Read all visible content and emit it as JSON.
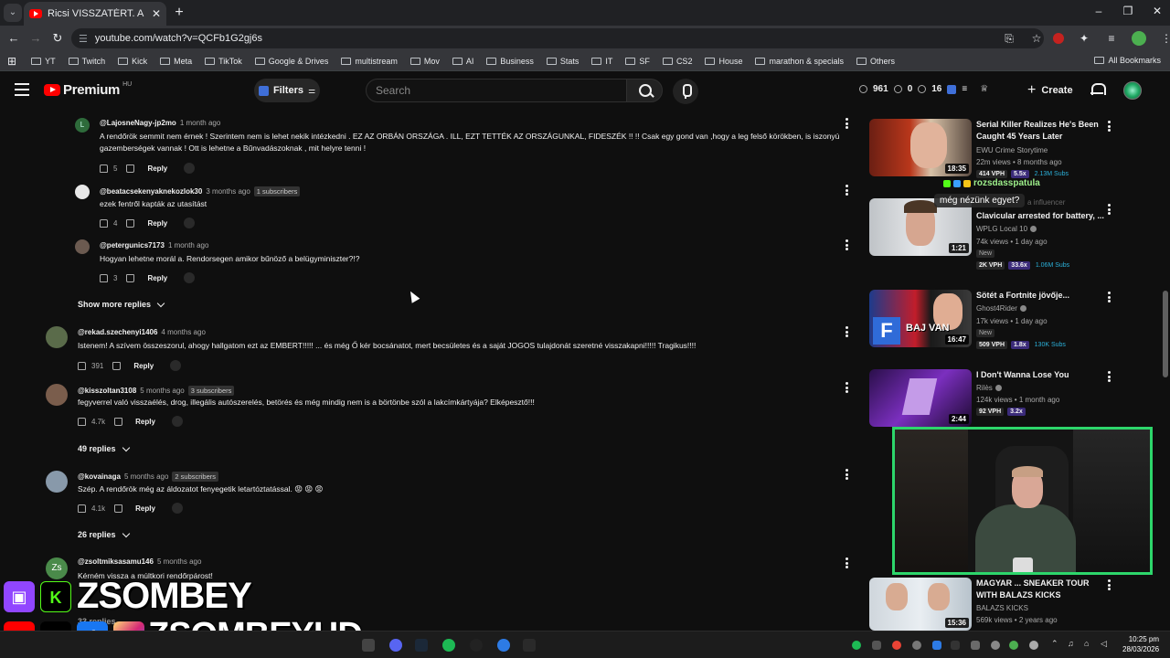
{
  "browser": {
    "tab_title": "Ricsi VISSZATÉRT.  A rendőrség",
    "url": "youtube.com/watch?v=QCFb1G2gj6s",
    "bookmarks": [
      "YT",
      "Twitch",
      "Kick",
      "Meta",
      "TikTok",
      "Google & Drives",
      "multistream",
      "Mov",
      "AI",
      "Business",
      "Stats",
      "IT",
      "SF",
      "CS2",
      "House",
      "marathon & specials",
      "Others"
    ],
    "all_bookmarks": "All Bookmarks"
  },
  "header": {
    "logo": "Premium",
    "country": "HU",
    "filters_label": "Filters",
    "search_placeholder": "Search",
    "stat1": "961",
    "stat2": "0",
    "stat3": "16",
    "create_label": "Create"
  },
  "comments": [
    {
      "handle": "@LajosneNagy-jp2mo",
      "time": "1 month ago",
      "subs": "",
      "text": "A rendőrök semmit nem érnek ! Szerintem nem is lehet nekik intézkedni . EZ AZ ORBÁN ORSZÁGA . ILL, EZT TETTÉK AZ ORSZÁGUNKAL, FIDESZÉK !! !! Csak egy gond van ,hogy a leg felső  körökben, is iszonyú gazemberségek vannak ! Ott is lehetne a Bűnvadászoknak , mit helyre tenni !",
      "likes": "5",
      "reply": "Reply",
      "avatar_letter": "L"
    },
    {
      "handle": "@beatacsekenyaknekozlok30",
      "time": "3 months ago",
      "subs": "1 subscribers",
      "text": "ezek fentről kapták az utasítást",
      "likes": "4",
      "reply": "Reply",
      "avatar_letter": ""
    },
    {
      "handle": "@petergunics7173",
      "time": "1 month ago",
      "subs": "",
      "text": "Hogyan lehetne morál a. Rendorsegen amikor bűnöző a belügyminiszter?!?",
      "likes": "3",
      "reply": "Reply",
      "avatar_letter": ""
    },
    {
      "handle": "@rekad.szechenyi1406",
      "time": "4 months ago",
      "subs": "",
      "text": "Istenem! A szívem összeszorul, ahogy hallgatom ezt az EMBERT!!!!! ... és még Ő kér bocsánatot, mert becsületes és a saját JOGOS tulajdonát szeretné visszakapni!!!!!  Tragikus!!!!",
      "likes": "391",
      "reply": "Reply",
      "avatar_letter": ""
    },
    {
      "handle": "@kisszoltan3108",
      "time": "5 months ago",
      "subs": "3 subscribers",
      "text": "fegyverrel való visszaélés, drog, illegális autószerelés, betörés és még mindig nem is a börtönbe szól a lakcímkártyája? Elképesztő!!!",
      "likes": "4.7k",
      "reply": "Reply",
      "avatar_letter": ""
    },
    {
      "handle": "@kovainaga",
      "time": "5 months ago",
      "subs": "2 subscribers",
      "text": "Szép. A rendőrök még az áldozatot fenyegetik letartóztatással. 😡 😡 😡",
      "likes": "4.1k",
      "reply": "Reply",
      "avatar_letter": ""
    },
    {
      "handle": "@zsoltmiksasamu146",
      "time": "5 months ago",
      "subs": "",
      "text": "Kérném  vissza a múltkori rendőrpárost!",
      "likes": "",
      "reply": "",
      "avatar_letter": "Zs"
    }
  ],
  "show_more_replies": "Show more replies",
  "replies_49": "49 replies",
  "replies_26": "26 replies",
  "replies_bottom": "33 replies",
  "recommendations": [
    {
      "title": "Serial Killer Realizes He's Been Caught 45 Years Later",
      "channel": "EWU Crime Storytime",
      "views": "22m views • 8 months ago",
      "duration": "18:35",
      "vph": "414 VPH",
      "ratio": "5.5x",
      "subs": "2.13M Subs",
      "new": ""
    },
    {
      "title": "Clavicular arrested for battery, ...",
      "channel": "WPLG Local 10",
      "views": "74k views • 1 day ago",
      "duration": "1:21",
      "vph": "2K VPH",
      "ratio": "33.6x",
      "subs": "1.06M Subs",
      "new": "New"
    },
    {
      "title": "Sötét a Fortnite jövője...",
      "channel": "Ghost4Rider",
      "views": "17k views • 1 day ago",
      "duration": "16:47",
      "vph": "509 VPH",
      "ratio": "1.8x",
      "subs": "130K Subs",
      "new": "New"
    },
    {
      "title": "I Don't Wanna Lose You",
      "channel": "Rilès",
      "views": "124k views • 1 month ago",
      "duration": "2:44",
      "vph": "92 VPH",
      "ratio": "3.2x",
      "subs": "",
      "new": ""
    },
    {
      "title": "MAGYAR ... SNEAKER TOUR WITH BALAZS KICKS",
      "channel": "BALAZS KICKS",
      "views": "569k views • 2 years ago",
      "duration": "15:36",
      "vph": "",
      "ratio": "",
      "subs": "",
      "new": ""
    }
  ],
  "thumb_text": {
    "baj_van": "BAJ VAN",
    "f": "F"
  },
  "stream": {
    "chat_user": "rozsdasspatula",
    "chat_message": "még nézünk egyet?",
    "ghost_text": "a influencer",
    "brand1": "ZSOMBEY",
    "brand2": "ZSOMBEYHD"
  },
  "taskbar": {
    "time": "10:25 pm",
    "date": "28/03/2026"
  },
  "colors": {
    "accent_green": "#2dd66b",
    "youtube_red": "#ff0000",
    "subs_blue": "#2bb0d9"
  }
}
